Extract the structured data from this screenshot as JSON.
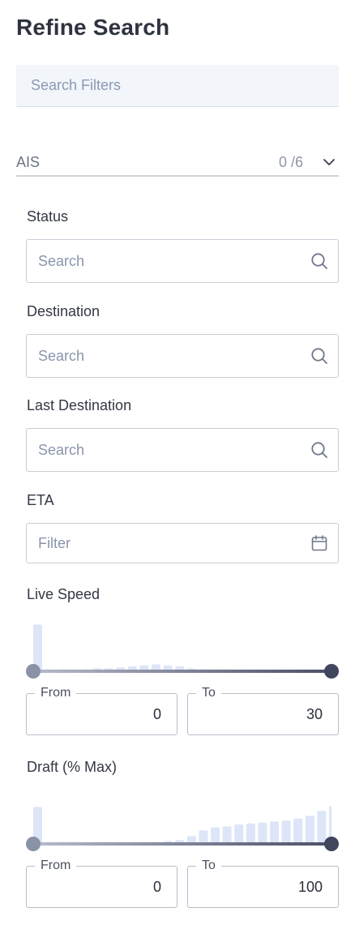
{
  "panel": {
    "title": "Refine Search",
    "filter_search": {
      "placeholder": "Search Filters",
      "value": ""
    }
  },
  "section": {
    "name": "AIS",
    "count": "0 /6",
    "icon": "chevron-down-icon"
  },
  "fields": {
    "status": {
      "label": "Status",
      "placeholder": "Search",
      "icon": "search-icon"
    },
    "destination": {
      "label": "Destination",
      "placeholder": "Search",
      "icon": "search-icon"
    },
    "last_destination": {
      "label": "Last Destination",
      "placeholder": "Search",
      "icon": "search-icon"
    },
    "eta": {
      "label": "ETA",
      "placeholder": "Filter",
      "icon": "calendar-icon"
    }
  },
  "live_speed": {
    "label": "Live Speed",
    "histogram": [
      48,
      2,
      2,
      2,
      2,
      3,
      3,
      4,
      5,
      6,
      7,
      6,
      5,
      3,
      2
    ],
    "range": {
      "min": 0,
      "max": 30
    },
    "from": {
      "label": "From",
      "value": "0"
    },
    "to": {
      "label": "To",
      "value": "30"
    }
  },
  "draft": {
    "label": "Draft (% Max)",
    "histogram": [
      38,
      2,
      2,
      2,
      2,
      2,
      2,
      2,
      2,
      2,
      2,
      3,
      4,
      8,
      14,
      17,
      18,
      20,
      21,
      22,
      23,
      24,
      26,
      29,
      34,
      39,
      44,
      50
    ],
    "range": {
      "min": 0,
      "max": 100
    },
    "from": {
      "label": "From",
      "value": "0"
    },
    "to": {
      "label": "To",
      "value": "100"
    }
  },
  "colors": {
    "histogram_bar": "#dde5f8",
    "slider_start": "#b7bccb",
    "slider_end": "#4b4e66",
    "handle_min": "#8a92a6",
    "handle_max": "#42455e"
  }
}
